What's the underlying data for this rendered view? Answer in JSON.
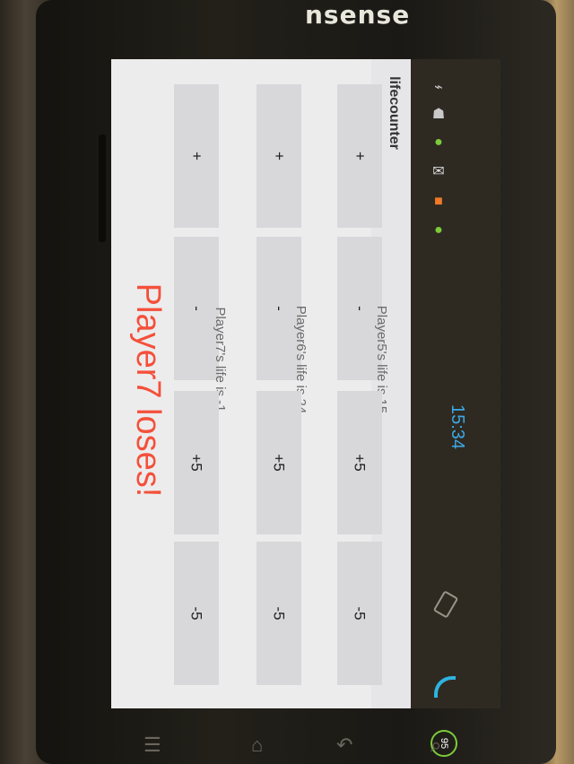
{
  "device": {
    "brand": "nsense"
  },
  "status_bar": {
    "time": "15:34",
    "battery": "95"
  },
  "app": {
    "title": "lifecounter"
  },
  "players": [
    {
      "label": "Player5's life is 15",
      "buttons": [
        "+",
        "-",
        "+5",
        "-5"
      ]
    },
    {
      "label": "Player6's life is 24",
      "buttons": [
        "+",
        "-",
        "+5",
        "-5"
      ]
    },
    {
      "label": "Player7's life is -1",
      "buttons": [
        "+",
        "-",
        "+5",
        "-5"
      ]
    }
  ],
  "message": "Player7 loses!",
  "colors": {
    "accent_time": "#3ca9e6",
    "loses_text": "#f4503a"
  },
  "icons": [
    "usb-icon",
    "android-icon",
    "sync-icon",
    "mail-icon",
    "app-icon",
    "android-market-icon",
    "rotate-icon",
    "wifi-icon",
    "battery-icon",
    "back-icon",
    "home-icon",
    "menu-icon",
    "search-icon"
  ]
}
